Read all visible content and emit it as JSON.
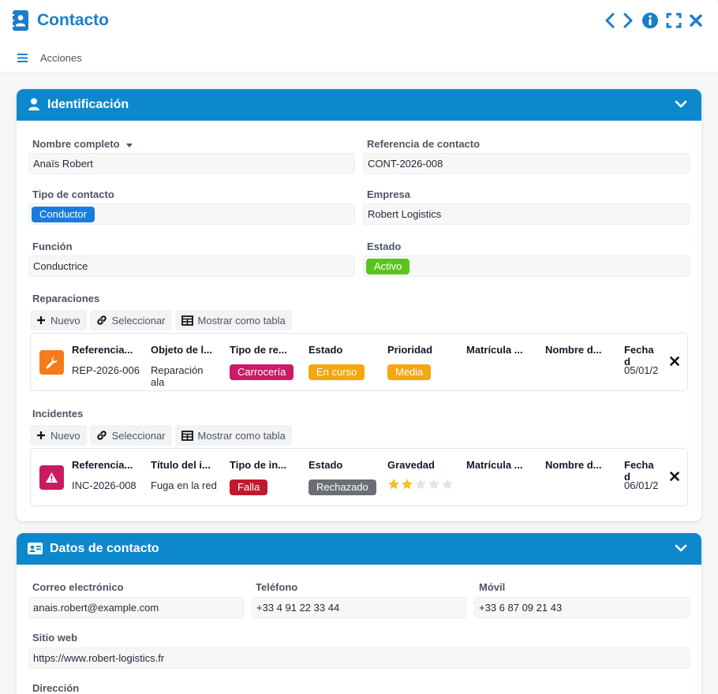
{
  "window": {
    "title": "Contacto",
    "actions_label": "Acciones"
  },
  "identificacion": {
    "title": "Identificación",
    "nombre_label": "Nombre completo",
    "nombre_value": "Anaïs Robert",
    "referencia_label": "Referencia de contacto",
    "referencia_value": "CONT-2026-008",
    "tipo_label": "Tipo de contacto",
    "tipo_value": "Conductor",
    "empresa_label": "Empresa",
    "empresa_value": "Robert Logistics",
    "funcion_label": "Función",
    "funcion_value": "Conductrice",
    "estado_label": "Estado",
    "estado_value": "Activo"
  },
  "toolbar": {
    "nuevo": "Nuevo",
    "seleccionar": "Seleccionar",
    "mostrar_tabla": "Mostrar como tabla"
  },
  "reparaciones": {
    "label": "Reparaciones",
    "columns": [
      "Referencia...",
      "Objeto de l...",
      "Tipo de re...",
      "Estado",
      "Prioridad",
      "Matrícula ...",
      "Nombre d...",
      "Fecha d"
    ],
    "row": {
      "referencia": "REP-2026-006",
      "objeto": "Reparación ala",
      "tipo": "Carrocería",
      "estado": "En curso",
      "prioridad": "Media",
      "fecha": "05/01/2"
    }
  },
  "incidentes": {
    "label": "Incidentes",
    "columns": [
      "Referencia...",
      "Título del i...",
      "Tipo de in...",
      "Estado",
      "Gravedad",
      "Matrícula ...",
      "Nombre d...",
      "Fecha d"
    ],
    "row": {
      "referencia": "INC-2026-008",
      "titulo": "Fuga en la red",
      "tipo": "Falla",
      "estado": "Rechazado",
      "gravedad_stars": 2,
      "gravedad_max": 5,
      "fecha": "06/01/2"
    }
  },
  "datos_contacto": {
    "title": "Datos de contacto",
    "correo_label": "Correo electrónico",
    "correo_value": "anais.robert@example.com",
    "telefono_label": "Teléfono",
    "telefono_value": "+33 4 91 22 33 44",
    "movil_label": "Móvil",
    "movil_value": "+33 6 87 09 21 43",
    "web_label": "Sitio web",
    "web_value": "https://www.robert-logistics.fr",
    "direccion_label": "Dirección"
  },
  "colors": {
    "accent": "#1a7ec9",
    "header_blue": "#0e88cc",
    "conductor": "#1a7ce0",
    "activo": "#5bc41a",
    "carroceria": "#cc1a66",
    "en_curso": "#f5a70d",
    "media": "#f5a70d",
    "falla": "#c0192d",
    "rechazado": "#6b6f75",
    "rep_icon": "#f57c18",
    "inc_icon": "#cc1a60",
    "star": "#f4c024"
  }
}
